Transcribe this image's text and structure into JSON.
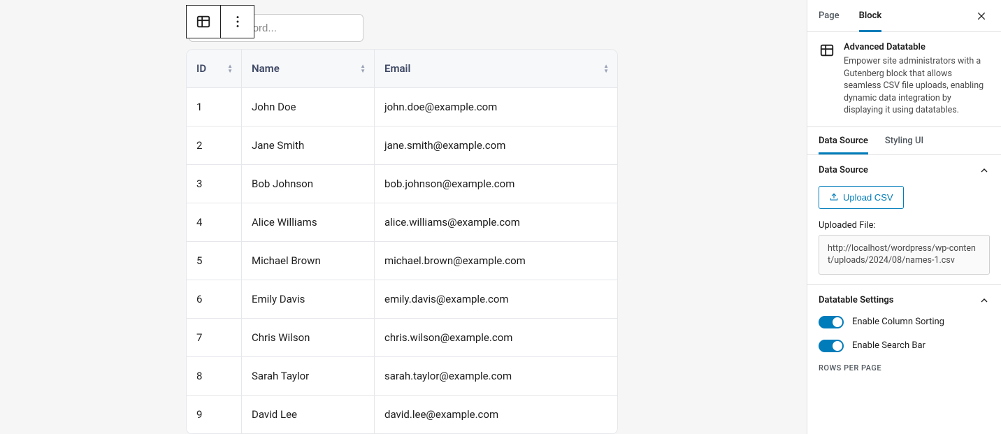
{
  "search": {
    "placeholder": "Enter Keyword..."
  },
  "table": {
    "columns": [
      "ID",
      "Name",
      "Email"
    ],
    "rows": [
      {
        "id": "1",
        "name": "John Doe",
        "email": "john.doe@example.com"
      },
      {
        "id": "2",
        "name": "Jane Smith",
        "email": "jane.smith@example.com"
      },
      {
        "id": "3",
        "name": "Bob Johnson",
        "email": "bob.johnson@example.com"
      },
      {
        "id": "4",
        "name": "Alice Williams",
        "email": "alice.williams@example.com"
      },
      {
        "id": "5",
        "name": "Michael Brown",
        "email": "michael.brown@example.com"
      },
      {
        "id": "6",
        "name": "Emily Davis",
        "email": "emily.davis@example.com"
      },
      {
        "id": "7",
        "name": "Chris Wilson",
        "email": "chris.wilson@example.com"
      },
      {
        "id": "8",
        "name": "Sarah Taylor",
        "email": "sarah.taylor@example.com"
      },
      {
        "id": "9",
        "name": "David Lee",
        "email": "david.lee@example.com"
      }
    ]
  },
  "sidebar": {
    "tabs": {
      "page": "Page",
      "block": "Block"
    },
    "block_card": {
      "title": "Advanced Datatable",
      "desc": "Empower site administrators with a Gutenberg block that allows seamless CSV file uploads, enabling dynamic data integration by displaying it using datatables."
    },
    "inner_tabs": {
      "data_source": "Data Source",
      "styling_ui": "Styling UI"
    },
    "data_source_panel": {
      "title": "Data Source",
      "upload_btn": "Upload CSV",
      "uploaded_label": "Uploaded File:",
      "uploaded_value": "http://localhost/wordpress/wp-content/uploads/2024/08/names-1.csv"
    },
    "settings_panel": {
      "title": "Datatable Settings",
      "sort_label": "Enable Column Sorting",
      "search_label": "Enable Search Bar",
      "rows_per_page_label": "ROWS PER PAGE"
    }
  }
}
